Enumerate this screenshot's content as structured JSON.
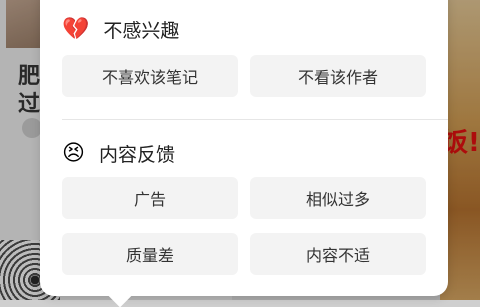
{
  "background": {
    "left_card_title_line1": "肥",
    "left_card_title_line2": "过",
    "right_card_promo": "饭!"
  },
  "popover": {
    "sections": [
      {
        "title": "不感兴趣",
        "icon": "broken-heart-icon",
        "icon_glyph": "💔",
        "options": [
          "不喜欢该笔记",
          "不看该作者"
        ]
      },
      {
        "title": "内容反馈",
        "icon": "annoyed-face-icon",
        "icon_glyph": "😣",
        "options": [
          "广告",
          "相似过多",
          "质量差",
          "内容不适"
        ]
      }
    ]
  },
  "colors": {
    "option_bg": "#f3f3f3",
    "promo_red": "#d40f0f"
  }
}
